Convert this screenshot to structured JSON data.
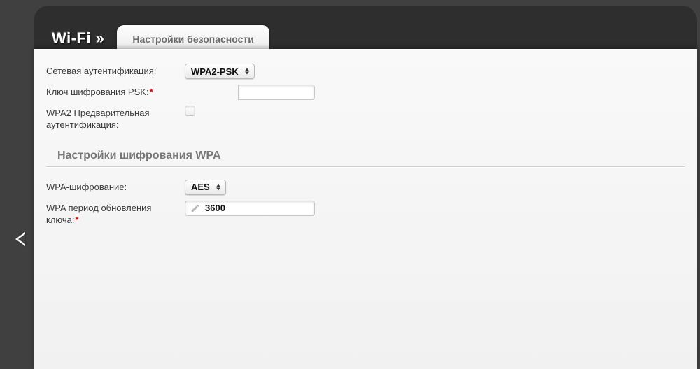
{
  "header": {
    "title": "Wi-Fi »",
    "tab": "Настройки безопасности"
  },
  "form": {
    "auth": {
      "label": "Сетевая аутентификация:",
      "value": "WPA2-PSK"
    },
    "psk": {
      "label": "Ключ шифрования PSK:",
      "value": ""
    },
    "preauth": {
      "label": "WPA2 Предварительная аутентификация:"
    }
  },
  "wpa": {
    "section": "Настройки шифрования WPA",
    "cipher": {
      "label": "WPA-шифрование:",
      "value": "AES"
    },
    "renew": {
      "label": "WPA период обновления ключа:",
      "value": "3600"
    }
  }
}
